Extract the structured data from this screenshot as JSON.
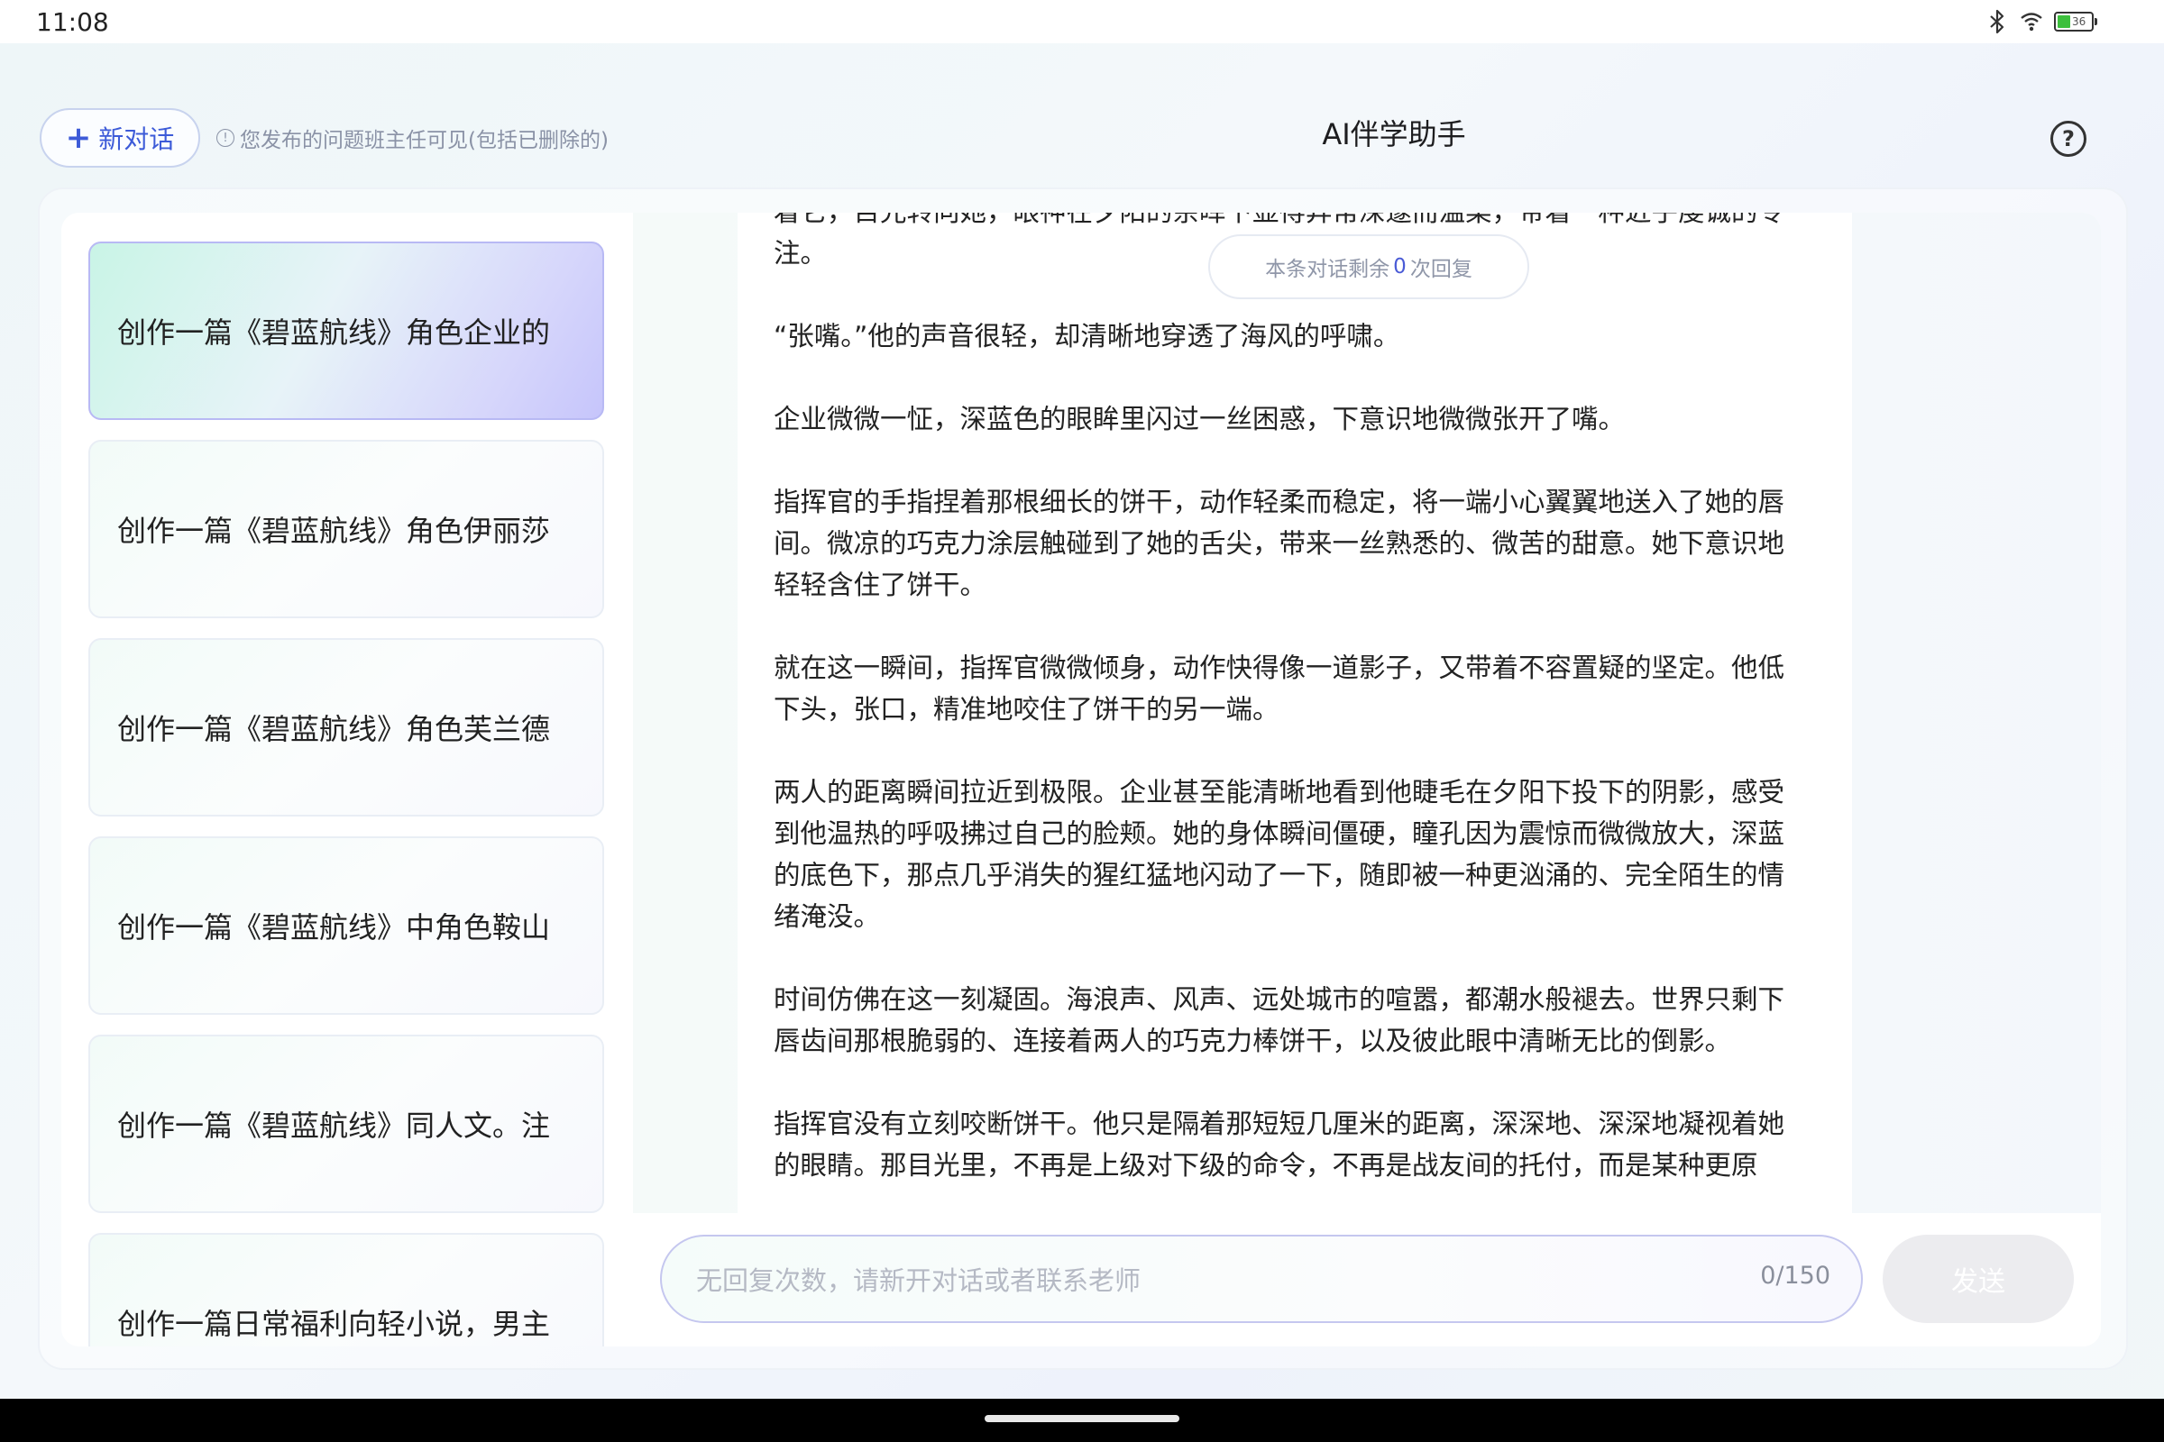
{
  "status_bar": {
    "time": "11:08",
    "battery_level": "36"
  },
  "header": {
    "new_chat_label": "新对话",
    "notice": "您发布的问题班主任可见(包括已删除的)",
    "title": "AI伴学助手",
    "help_symbol": "?"
  },
  "sidebar": {
    "items": [
      {
        "label": "创作一篇《碧蓝航线》角色企业的",
        "active": true
      },
      {
        "label": "创作一篇《碧蓝航线》角色伊丽莎",
        "active": false
      },
      {
        "label": "创作一篇《碧蓝航线》角色芙兰德",
        "active": false
      },
      {
        "label": "创作一篇《碧蓝航线》中角色鞍山",
        "active": false
      },
      {
        "label": "创作一篇《碧蓝航线》同人文。注",
        "active": false
      },
      {
        "label": "创作一篇日常福利向轻小说，男主",
        "active": false
      }
    ]
  },
  "chat": {
    "remaining_prefix": "本条对话剩余",
    "remaining_count": "0",
    "remaining_suffix": "次回复",
    "paragraphs": [
      "着它，目光转向她，眼神在夕阳的余晖下显得异常深邃而温柔，带着一种近乎虔诚的专注。",
      "“张嘴。”他的声音很轻，却清晰地穿透了海风的呼啸。",
      "企业微微一怔，深蓝色的眼眸里闪过一丝困惑，下意识地微微张开了嘴。",
      "指挥官的手指捏着那根细长的饼干，动作轻柔而稳定，将一端小心翼翼地送入了她的唇间。微凉的巧克力涂层触碰到了她的舌尖，带来一丝熟悉的、微苦的甜意。她下意识地轻轻含住了饼干。",
      "就在这一瞬间，指挥官微微倾身，动作快得像一道影子，又带着不容置疑的坚定。他低下头，张口，精准地咬住了饼干的另一端。",
      "两人的距离瞬间拉近到极限。企业甚至能清晰地看到他睫毛在夕阳下投下的阴影，感受到他温热的呼吸拂过自己的脸颊。她的身体瞬间僵硬，瞳孔因为震惊而微微放大，深蓝的底色下，那点几乎消失的猩红猛地闪动了一下，随即被一种更汹涌的、完全陌生的情绪淹没。",
      "时间仿佛在这一刻凝固。海浪声、风声、远处城市的喧嚣，都潮水般褪去。世界只剩下唇齿间那根脆弱的、连接着两人的巧克力棒饼干，以及彼此眼中清晰无比的倒影。",
      "指挥官没有立刻咬断饼干。他只是隔着那短短几厘米的距离，深深地、深深地凝视着她的眼睛。那目光里，不再是上级对下级的命令，不再是战友间的托付，而是某种更原"
    ]
  },
  "input": {
    "placeholder": "无回复次数，请新开对话或者联系老师",
    "char_count": "0/150",
    "send_label": "发送"
  },
  "colors": {
    "accent": "#3d5bd8",
    "active_item_border": "#b8b9f4",
    "send_disabled": "#ececef"
  }
}
